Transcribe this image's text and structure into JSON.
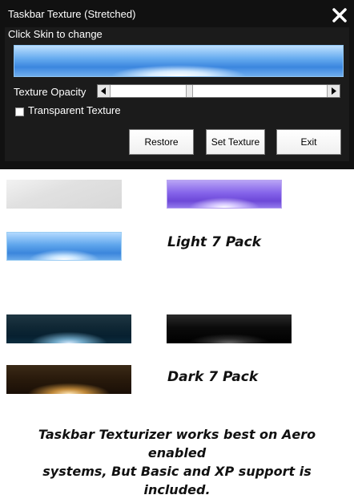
{
  "window": {
    "title": "Taskbar Texture (Stretched)",
    "hint": "Click Skin to change",
    "opacity_label": "Texture Opacity",
    "opacity_value_fraction": 0.36,
    "transparent_label": "Transparent Texture",
    "transparent_checked": false,
    "buttons": {
      "restore": "Restore",
      "set_texture": "Set Texture",
      "exit": "Exit"
    },
    "icons": {
      "close": "close-icon",
      "left": "left-arrow-icon",
      "right": "right-arrow-icon"
    }
  },
  "textures": {
    "light_label": "Light 7 Pack",
    "dark_label": "Dark 7 Pack"
  },
  "footer": {
    "line1": "Taskbar Texturizer works best on Aero enabled",
    "line2": "systems, But Basic and XP support is included."
  },
  "colors": {
    "window_bg": "#111111",
    "accent_blue": "#3b86df"
  }
}
